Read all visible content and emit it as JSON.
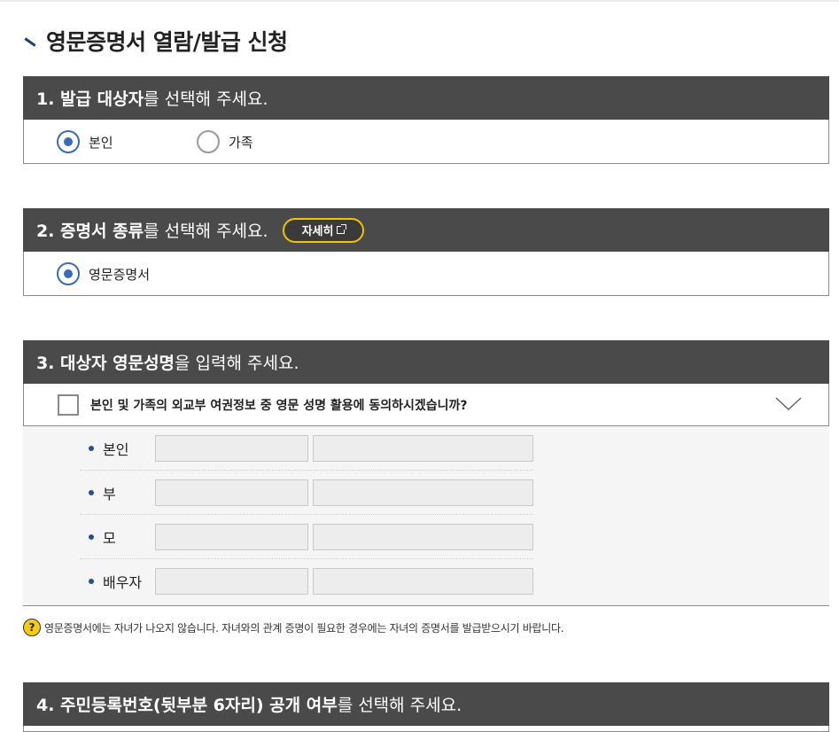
{
  "page": {
    "title": "영문증명서 열람/발급 신청"
  },
  "section1": {
    "heading_bold": "1. 발급 대상자",
    "heading_rest": "를 선택해 주세요.",
    "options": [
      {
        "label": "본인",
        "selected": true
      },
      {
        "label": "가족",
        "selected": false
      }
    ]
  },
  "section2": {
    "heading_bold": "2. 증명서 종류",
    "heading_rest": "를 선택해 주세요.",
    "detail_button": "자세히",
    "options": [
      {
        "label": "영문증명서",
        "selected": true
      }
    ]
  },
  "section3": {
    "heading_bold": "3. 대상자 영문성명",
    "heading_rest": "을 입력해 주세요.",
    "consent_text": "본인 및 가족의 외교부 여권정보 중 영문 성명 활용에 동의하시겠습니까?",
    "consent_checked": false,
    "rows": [
      {
        "label": "본인",
        "first_value": "",
        "second_value": ""
      },
      {
        "label": "부",
        "first_value": "",
        "second_value": ""
      },
      {
        "label": "모",
        "first_value": "",
        "second_value": ""
      },
      {
        "label": "배우자",
        "first_value": "",
        "second_value": ""
      }
    ]
  },
  "notice": {
    "icon": "question-icon",
    "text": "영문증명서에는 자녀가 나오지 않습니다. 자녀와의 관계 증명이 필요한 경우에는 자녀의 증명서를 발급받으시기 바랍니다."
  },
  "section4": {
    "heading_bold": "4. 주민등록번호(뒷부분 6자리) 공개 여부",
    "heading_rest": "를 선택해 주세요."
  },
  "colors": {
    "header_bg": "#4a4a4a",
    "radio_accent": "#3c6bb5",
    "button_border": "#f1c400",
    "notice_icon": "#f6cb14"
  }
}
